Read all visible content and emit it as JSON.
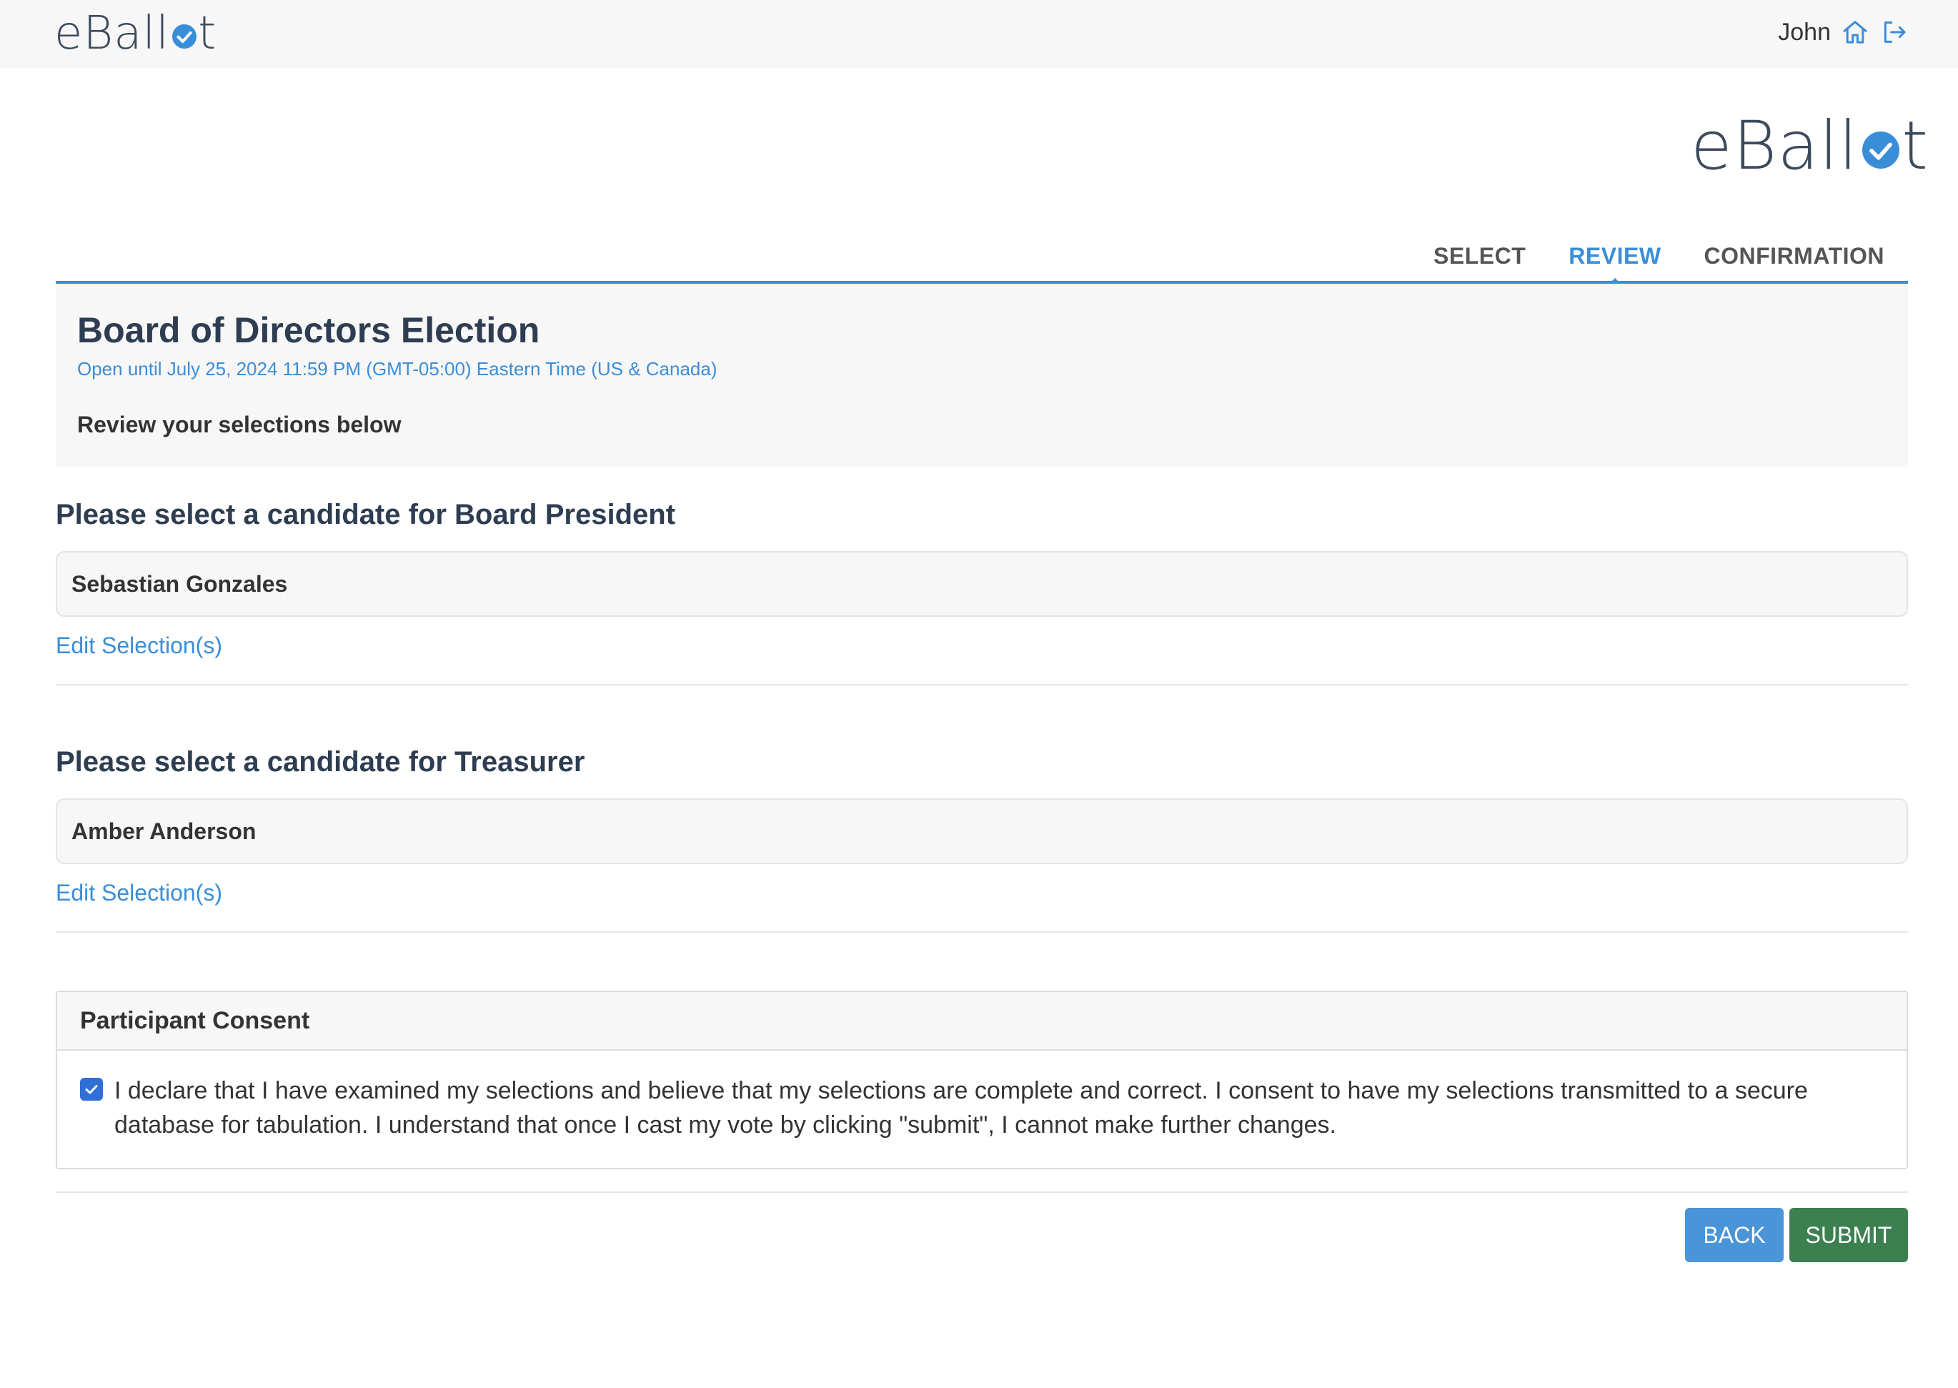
{
  "topbar": {
    "logo_prefix": "eBall",
    "logo_suffix": "t",
    "user_name": "John",
    "icons": [
      "home-icon",
      "logout-icon"
    ]
  },
  "brand": {
    "logo_prefix": "eBall",
    "logo_suffix": "t",
    "accent_color": "#3a8ed8"
  },
  "steps": [
    {
      "label": "SELECT",
      "active": false
    },
    {
      "label": "REVIEW",
      "active": true
    },
    {
      "label": "CONFIRMATION",
      "active": false
    }
  ],
  "election": {
    "title": "Board of Directors Election",
    "open_until": "Open until July 25, 2024 11:59 PM (GMT-05:00) Eastern Time (US & Canada)",
    "instructions": "Review your selections below"
  },
  "questions": [
    {
      "title": "Please select a candidate for Board President",
      "selection": "Sebastian Gonzales",
      "edit_label": "Edit Selection(s)"
    },
    {
      "title": "Please select a candidate for Treasurer",
      "selection": "Amber Anderson",
      "edit_label": "Edit Selection(s)"
    }
  ],
  "consent": {
    "title": "Participant Consent",
    "checked": true,
    "text": "I declare that I have examined my selections and believe that my selections are complete and correct. I consent to have my selections transmitted to a secure database for tabulation. I understand that once I cast my vote by clicking \"submit\", I cannot make further changes."
  },
  "actions": {
    "back_label": "BACK",
    "submit_label": "SUBMIT",
    "back_color": "#4a94d8",
    "submit_color": "#3c8050"
  }
}
